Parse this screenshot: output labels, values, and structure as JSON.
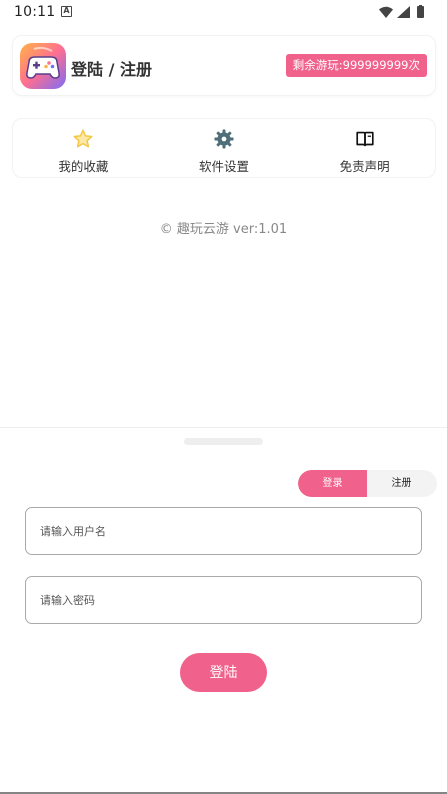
{
  "status_bar": {
    "time": "10:11",
    "notification_letter": "A",
    "icons": [
      "wifi-icon",
      "signal-icon",
      "battery-icon"
    ]
  },
  "header": {
    "title": "登陆 / 注册",
    "remaining": "剩余游玩:999999999次",
    "app_icon": "gamepad-icon"
  },
  "menu": {
    "items": [
      {
        "label": "我的收藏",
        "icon": "star-icon"
      },
      {
        "label": "软件设置",
        "icon": "gear-icon"
      },
      {
        "label": "免责声明",
        "icon": "book-icon"
      }
    ]
  },
  "version": "© 趣玩云游 ver:1.01",
  "auth": {
    "tabs": {
      "login": "登录",
      "register": "注册"
    },
    "username_placeholder": "请输入用户名",
    "password_placeholder": "请输入密码",
    "submit_label": "登陆"
  },
  "colors": {
    "accent": "#f0618c",
    "gear": "#4e6e78",
    "star": "#f3c745"
  }
}
